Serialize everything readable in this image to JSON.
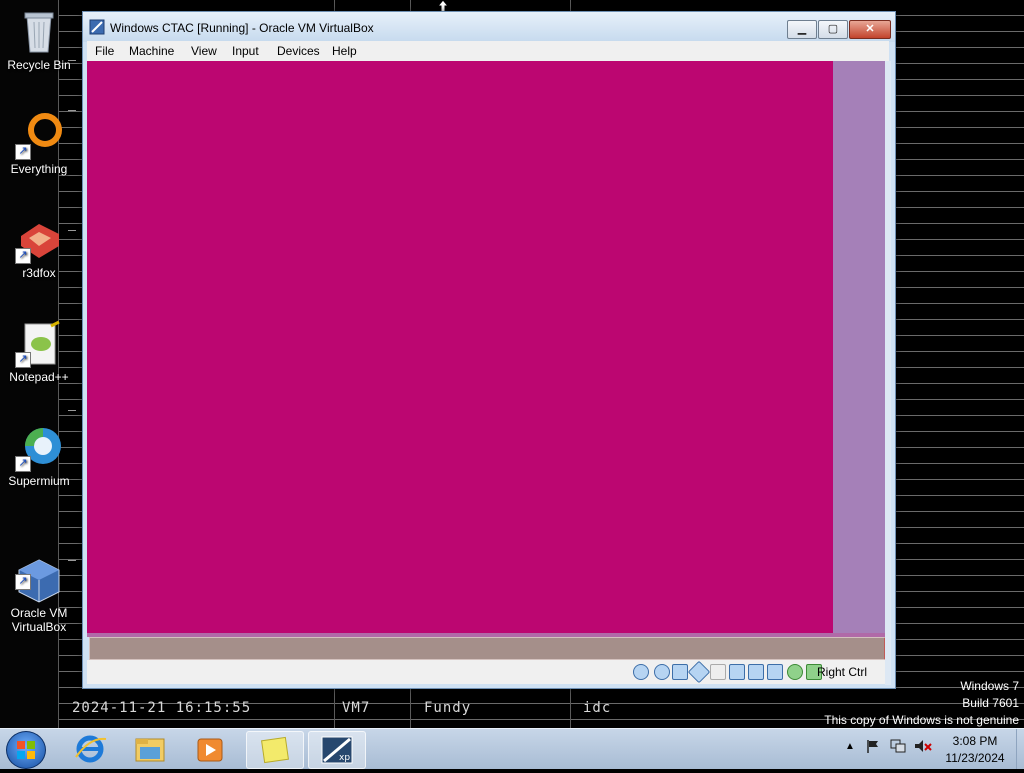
{
  "desktop": {
    "icons": [
      {
        "label": "Recycle Bin"
      },
      {
        "label": "Everything"
      },
      {
        "label": "r3dfox"
      },
      {
        "label": "Notepad++"
      },
      {
        "label": "Supermium"
      },
      {
        "label": "Oracle VM\nVirtualBox"
      }
    ],
    "log_rows": [
      {
        "date": "2024-11-21 16:15:55",
        "vm": "VM7",
        "user": "Fundy",
        "group": "idc"
      }
    ]
  },
  "window": {
    "title": "Windows CTAC [Running] - Oracle VM VirtualBox",
    "menu": [
      "File",
      "Machine",
      "View",
      "Input",
      "Devices",
      "Help"
    ],
    "host_key": "Right Ctrl",
    "guest_color": "#bc0671"
  },
  "taskbar": {
    "time": "3:08 PM",
    "date": "11/23/2024",
    "watermark": {
      "line1": "Windows 7",
      "line2": "Build 7601",
      "line3": "This copy of Windows is not genuine"
    }
  }
}
